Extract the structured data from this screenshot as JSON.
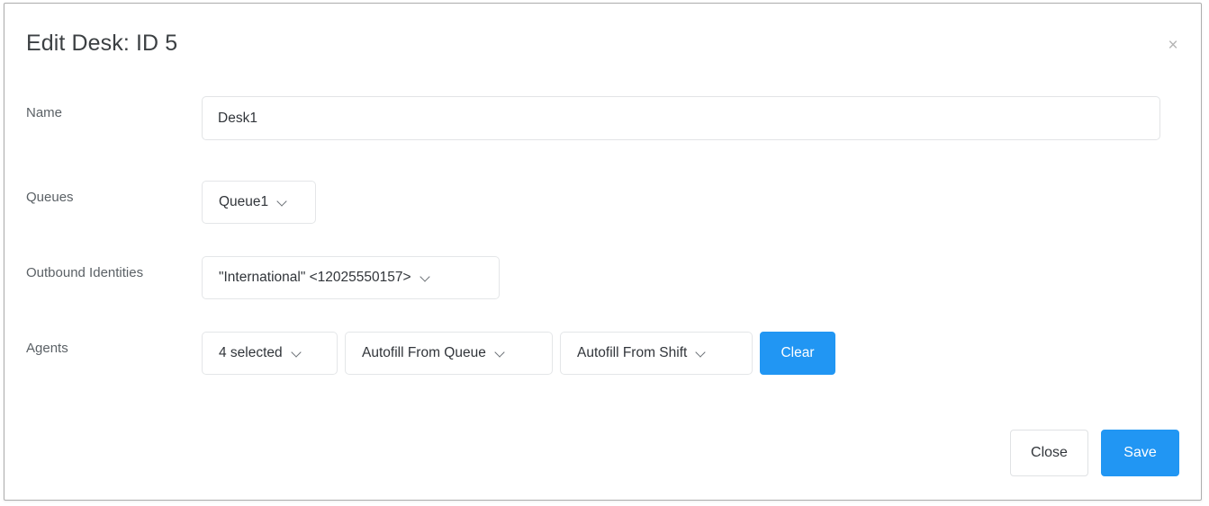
{
  "modal": {
    "title": "Edit Desk: ID 5",
    "close_icon": "close-icon",
    "close_glyph": "×"
  },
  "form": {
    "name": {
      "label": "Name",
      "value": "Desk1",
      "placeholder": ""
    },
    "queues": {
      "label": "Queues",
      "selected": "Queue1"
    },
    "outbound_identities": {
      "label": "Outbound Identities",
      "selected": "\"International\" <12025550157>"
    },
    "agents": {
      "label": "Agents",
      "selected": "4 selected",
      "autofill_from_queue": "Autofill From Queue",
      "autofill_from_shift": "Autofill From Shift",
      "clear_label": "Clear"
    }
  },
  "footer": {
    "close_label": "Close",
    "save_label": "Save"
  },
  "colors": {
    "primary": "#2196f3",
    "border": "#e2e4e6",
    "modal_border": "#adadad",
    "label_text": "#5b6166",
    "value_text": "#31353a",
    "title_text": "#3c4043",
    "close_icon": "#b4b4b4"
  }
}
